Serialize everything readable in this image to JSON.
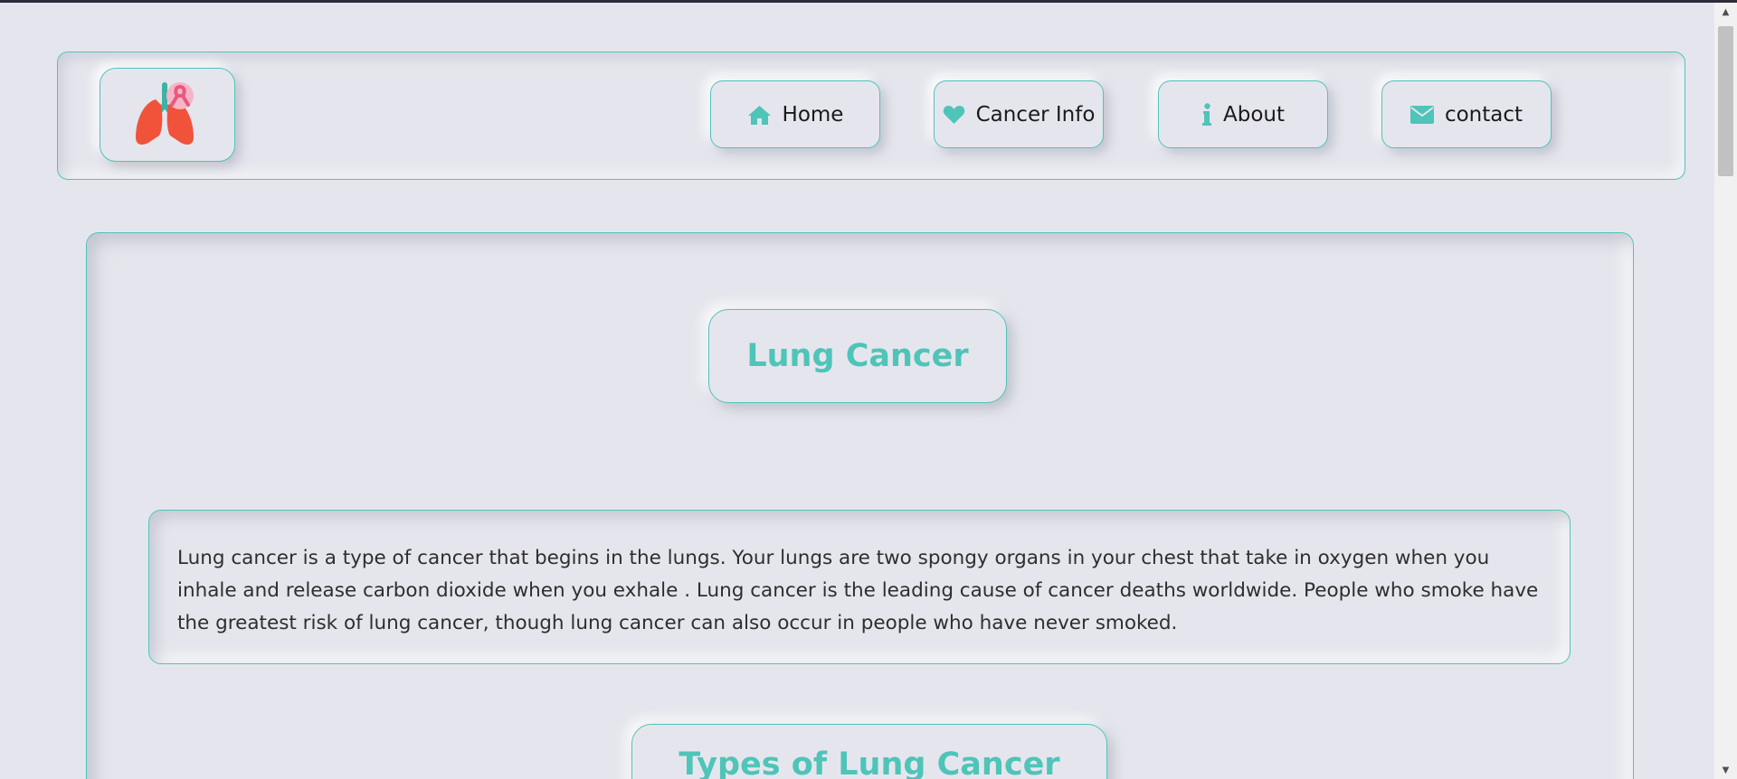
{
  "nav": {
    "items": [
      {
        "label": "Home",
        "icon": "home-icon"
      },
      {
        "label": "Cancer Info",
        "icon": "heart-icon"
      },
      {
        "label": "About",
        "icon": "info-icon"
      },
      {
        "label": "contact",
        "icon": "envelope-icon"
      }
    ]
  },
  "logo": {
    "icon": "lungs-ribbon-logo"
  },
  "main": {
    "title": "Lung Cancer",
    "description": "Lung cancer is a type of cancer that begins in the lungs. Your lungs are two spongy organs in your chest that take in oxygen when you inhale and release carbon dioxide when you exhale . Lung cancer is the leading cause of cancer deaths worldwide. People who smoke have the greatest risk of lung cancer, though lung cancer can also occur in people who have never smoked.",
    "section_title": "Types of Lung Cancer"
  },
  "colors": {
    "accent": "#4fc4b9",
    "background": "#e5e6ed",
    "text": "#2e2e2e"
  }
}
